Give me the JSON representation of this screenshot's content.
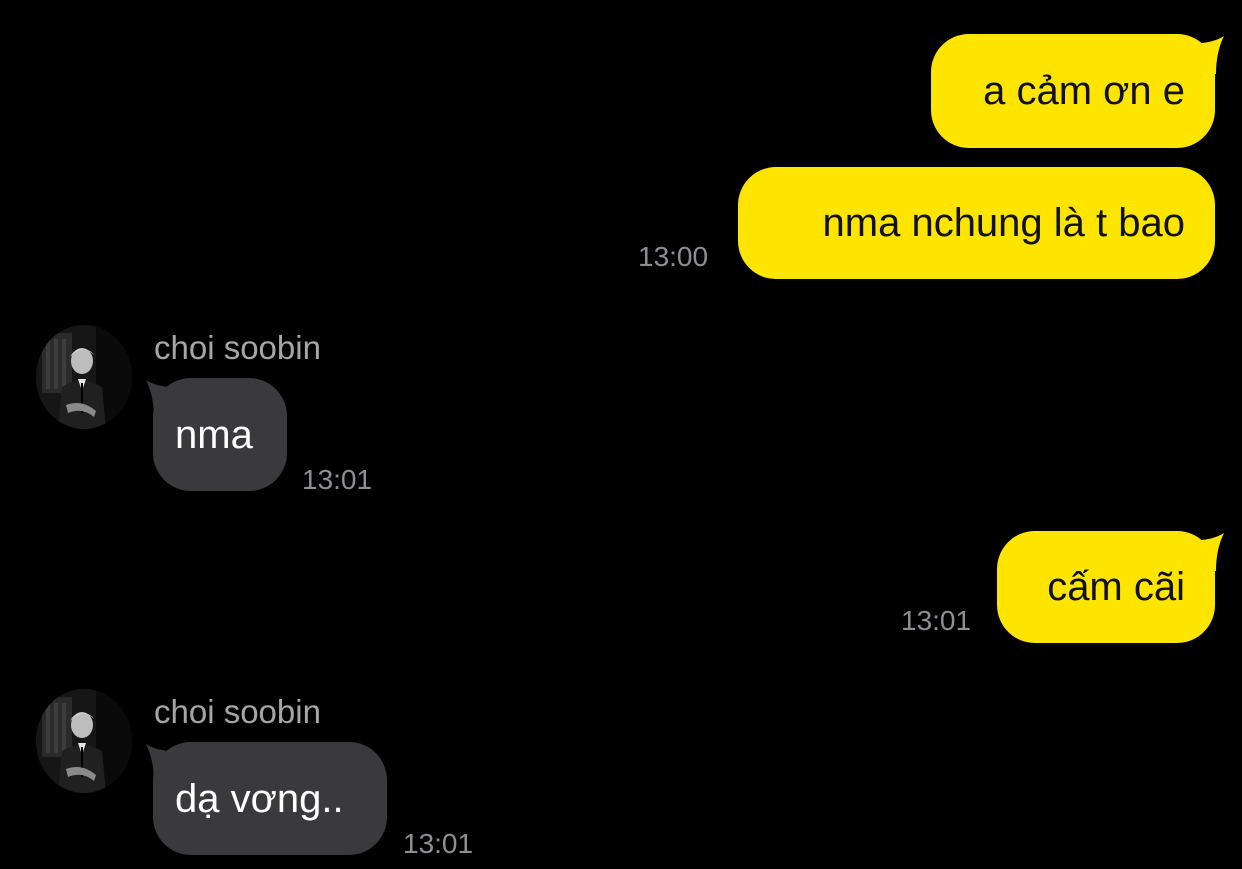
{
  "colors": {
    "background": "#000000",
    "sent_bubble": "#FEE500",
    "received_bubble": "#3A3A3C",
    "timestamp": "#8E8E93",
    "sender_name": "#A6A6A6"
  },
  "messages": [
    {
      "direction": "sent",
      "text": "a cảm ơn e",
      "time": ""
    },
    {
      "direction": "sent",
      "text": "nma nchung là t bao",
      "time": "13:00"
    },
    {
      "direction": "received",
      "sender": "choi soobin",
      "avatar_icon": "profile-photo",
      "text": "nma",
      "time": "13:01"
    },
    {
      "direction": "sent",
      "text": "cấm cãi",
      "time": "13:01"
    },
    {
      "direction": "received",
      "sender": "choi soobin",
      "avatar_icon": "profile-photo",
      "text": "dạ vơng..",
      "time": "13:01"
    }
  ]
}
